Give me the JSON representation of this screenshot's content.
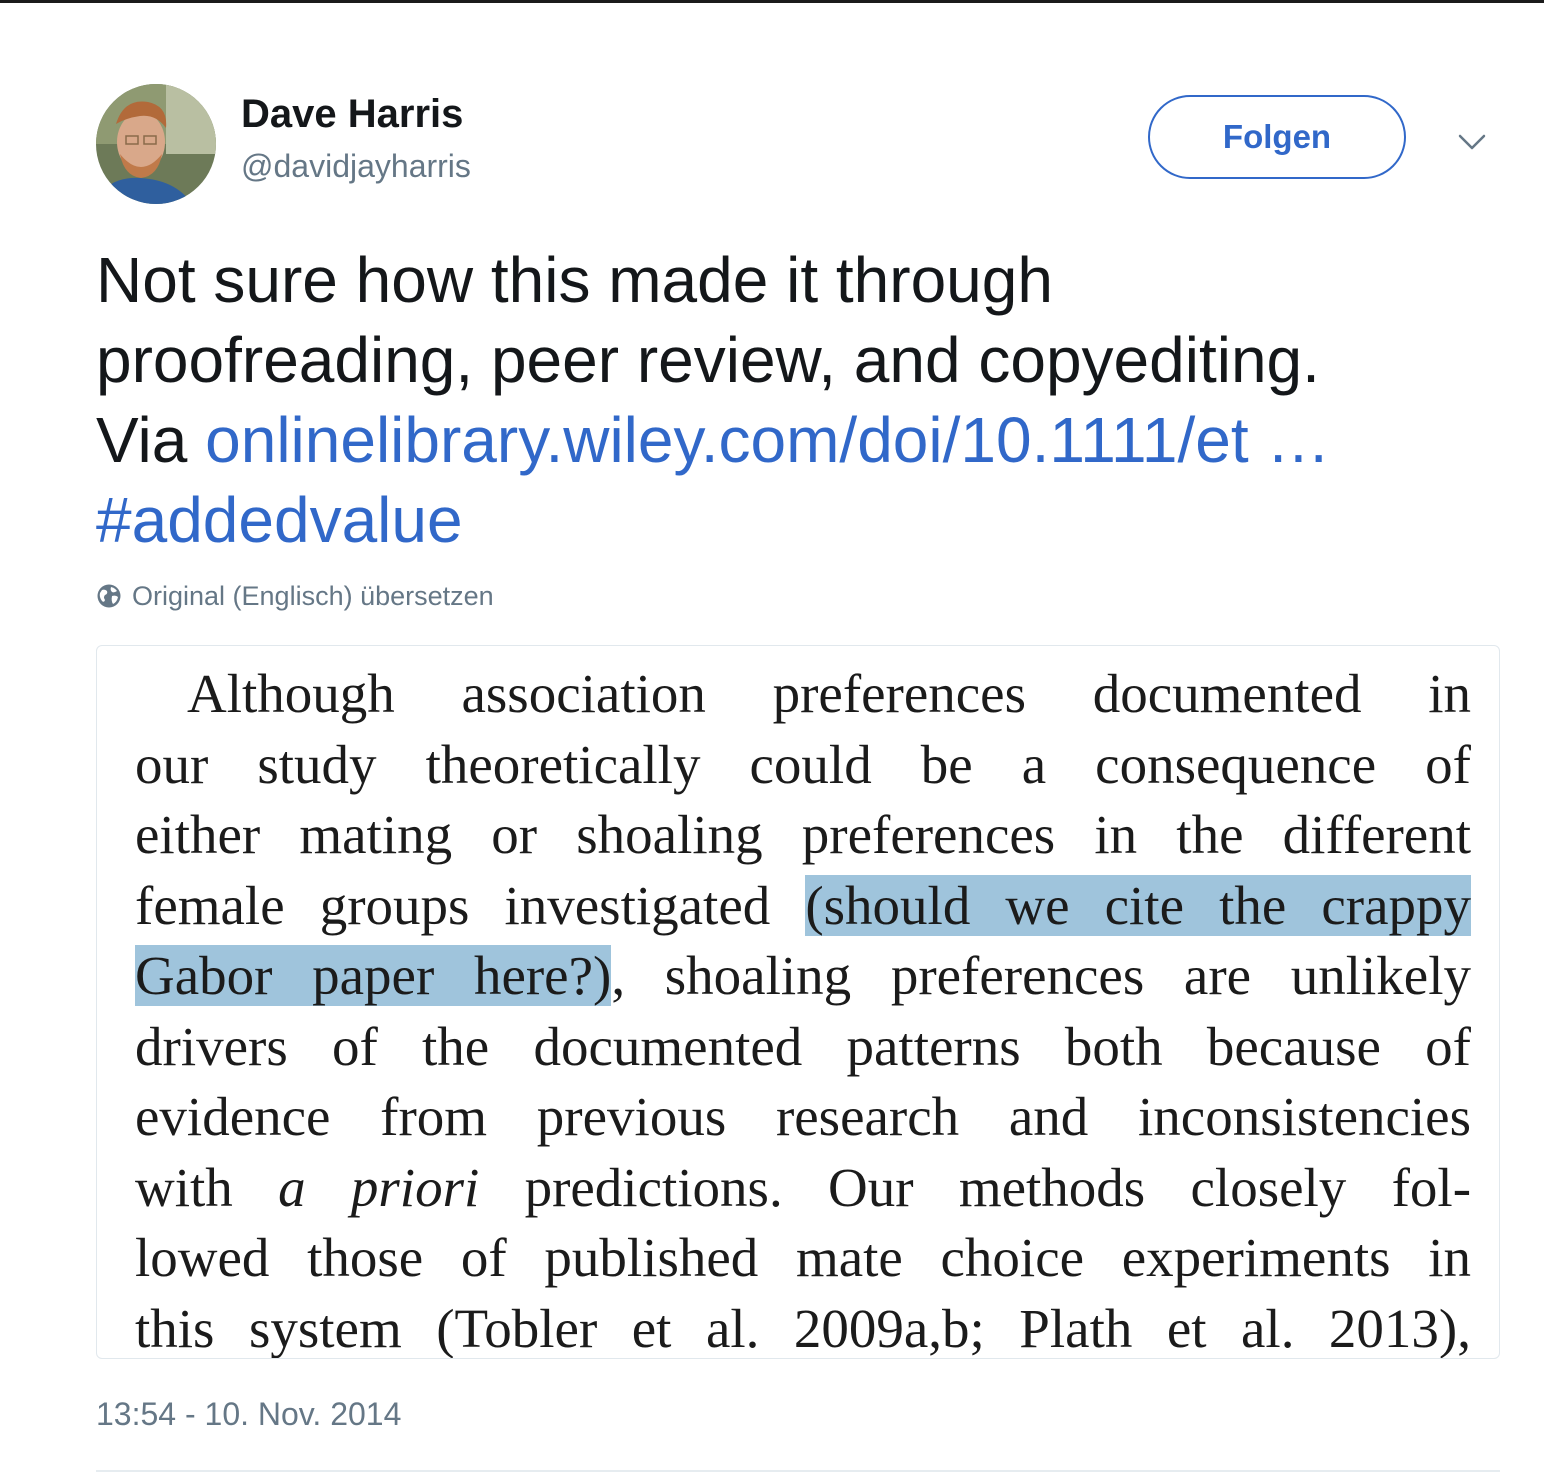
{
  "author": {
    "display_name": "Dave Harris",
    "handle": "@davidjayharris"
  },
  "follow_button": {
    "label": "Folgen"
  },
  "tweet": {
    "text_line1": "Not sure how this made it through",
    "text_line2": "proofreading, peer review, and copyediting.",
    "text_via": "Via ",
    "link_text": "onlinelibrary.wiley.com/doi/10.1111/et …",
    "hashtag": "#addedvalue"
  },
  "translate": {
    "label": "Original (Englisch) übersetzen",
    "icon": "globe-icon"
  },
  "excerpt": {
    "row1": "Although association preferences documented in",
    "row2": "our study theoretically could be a consequence of",
    "row3": "either mating or shoaling preferences in the different",
    "row4_plain": "female groups investigated ",
    "row4_highlight": "(should we cite the crappy",
    "row5_highlight": "Gabor paper here?)",
    "row5_plain": ", shoaling preferences are unlikely",
    "row6": "drivers of the documented patterns both because of",
    "row7": "evidence from previous research and inconsistencies",
    "row8_pre": "with ",
    "row8_italic": "a priori",
    "row8_post": " predictions. Our methods closely fol-",
    "row9": "lowed those of published mate choice experiments in",
    "row10": "this system (Tobler et al. 2009a,b; Plath et al. 2013),",
    "highlight_color": "#9fc4dc"
  },
  "timestamp": "13:54 - 10. Nov. 2014",
  "colors": {
    "link": "#3168c9",
    "secondary_text": "#657786",
    "primary_text": "#14171a"
  }
}
